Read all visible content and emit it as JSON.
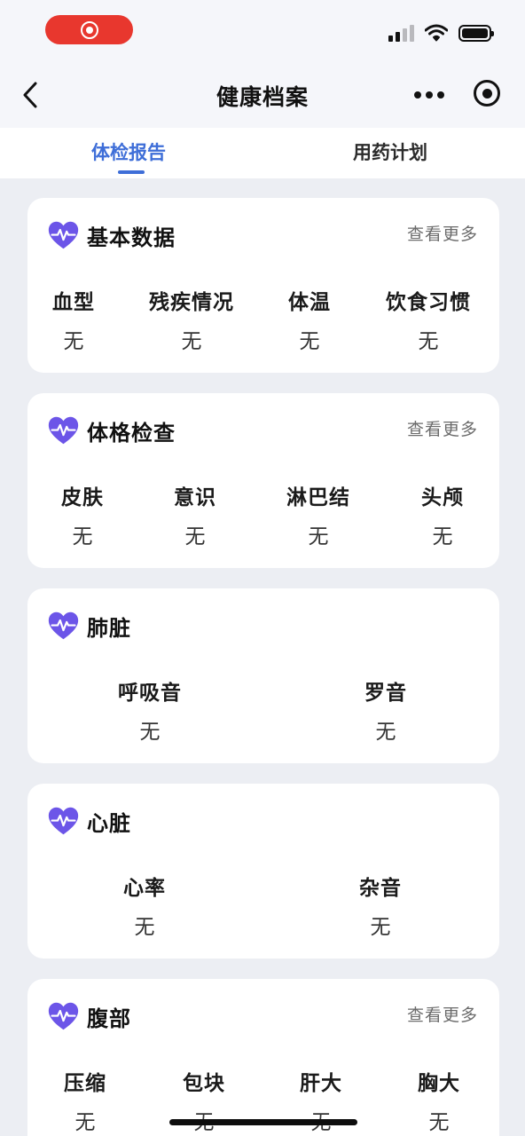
{
  "nav": {
    "title": "健康档案"
  },
  "tabs": [
    {
      "label": "体检报告",
      "active": true
    },
    {
      "label": "用药计划",
      "active": false
    }
  ],
  "colors": {
    "accent": "#3e6ed8",
    "heart": "#6c55e8",
    "record": "#e8372e"
  },
  "cards": [
    {
      "title": "基本数据",
      "more": "查看更多",
      "fields": [
        {
          "label": "血型",
          "value": "无"
        },
        {
          "label": "残疾情况",
          "value": "无"
        },
        {
          "label": "体温",
          "value": "无"
        },
        {
          "label": "饮食习惯",
          "value": "无"
        }
      ]
    },
    {
      "title": "体格检查",
      "more": "查看更多",
      "fields": [
        {
          "label": "皮肤",
          "value": "无"
        },
        {
          "label": "意识",
          "value": "无"
        },
        {
          "label": "淋巴结",
          "value": "无"
        },
        {
          "label": "头颅",
          "value": "无"
        }
      ]
    },
    {
      "title": "肺脏",
      "fields": [
        {
          "label": "呼吸音",
          "value": "无"
        },
        {
          "label": "罗音",
          "value": "无"
        }
      ]
    },
    {
      "title": "心脏",
      "fields": [
        {
          "label": "心率",
          "value": "无"
        },
        {
          "label": "杂音",
          "value": "无"
        }
      ]
    },
    {
      "title": "腹部",
      "more": "查看更多",
      "fields": [
        {
          "label": "压缩",
          "value": "无"
        },
        {
          "label": "包块",
          "value": "无"
        },
        {
          "label": "肝大",
          "value": "无"
        },
        {
          "label": "胸大",
          "value": "无"
        }
      ]
    }
  ]
}
